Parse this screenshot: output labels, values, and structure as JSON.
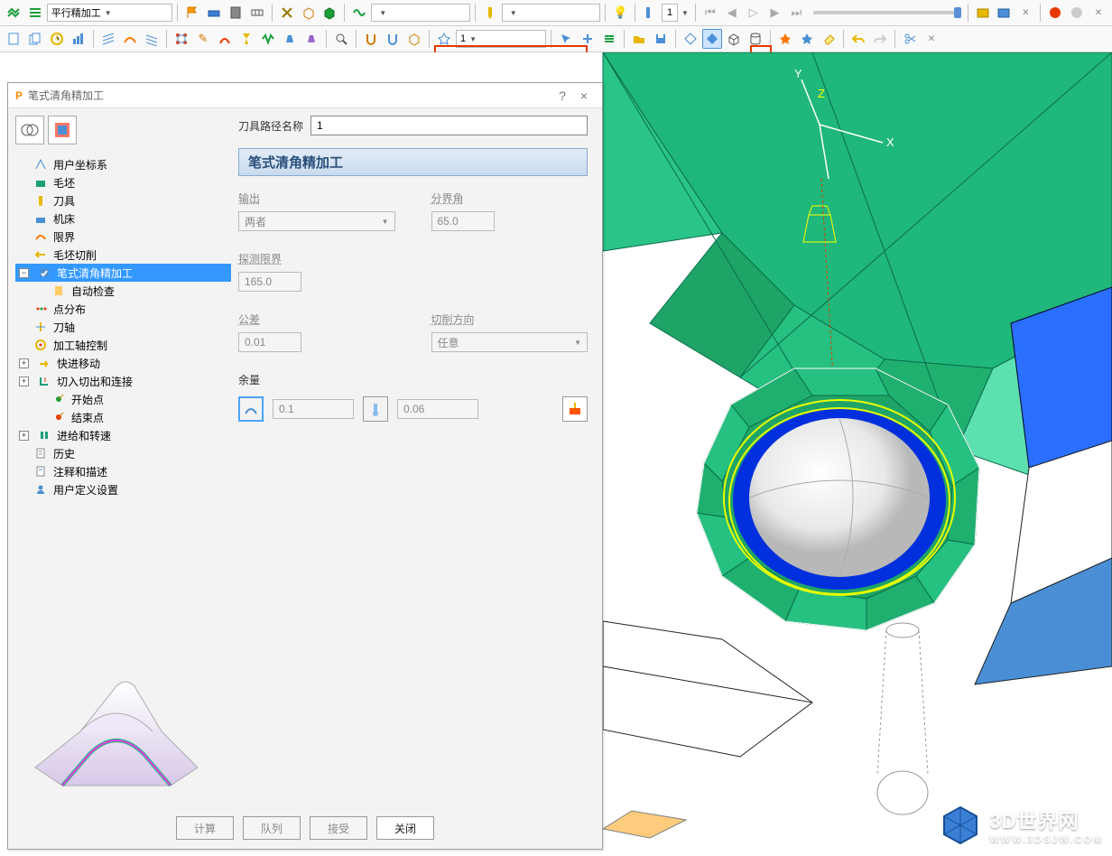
{
  "toolbar1": {
    "strategy": "平行精加工",
    "dd2_value": "",
    "dd3_value": "",
    "counter": "1"
  },
  "toolbar2": {
    "boundary_value": "1"
  },
  "dialog": {
    "title": "笔式清角精加工",
    "help": "?",
    "close": "×",
    "name_label": "刀具路径名称",
    "name_value": "1",
    "section_header": "笔式清角精加工",
    "tree": [
      "用户坐标系",
      "毛坯",
      "刀具",
      "机床",
      "限界",
      "毛坯切削",
      "笔式清角精加工",
      "自动检查",
      "点分布",
      "刀轴",
      "加工轴控制",
      "快进移动",
      "切入切出和连接",
      "开始点",
      "结束点",
      "进给和转速",
      "历史",
      "注释和描述",
      "用户定义设置"
    ],
    "form": {
      "output_lbl": "输出",
      "output_val": "两者",
      "angle_lbl": "分界角",
      "angle_val": "65.0",
      "detect_lbl": "探测限界",
      "detect_val": "165.0",
      "tol_lbl": "公差",
      "tol_val": "0.01",
      "cutdir_lbl": "切削方向",
      "cutdir_val": "任意",
      "allow_lbl": "余量",
      "allow1": "0.1",
      "allow2": "0.06"
    },
    "buttons": {
      "calc": "计算",
      "queue": "队列",
      "accept": "接受",
      "close_btn": "关闭"
    }
  },
  "watermark": {
    "title": "3D世界网",
    "url": "WWW.3DSJW.COM"
  },
  "axes": {
    "x": "X",
    "y": "Y",
    "z": "Z"
  }
}
